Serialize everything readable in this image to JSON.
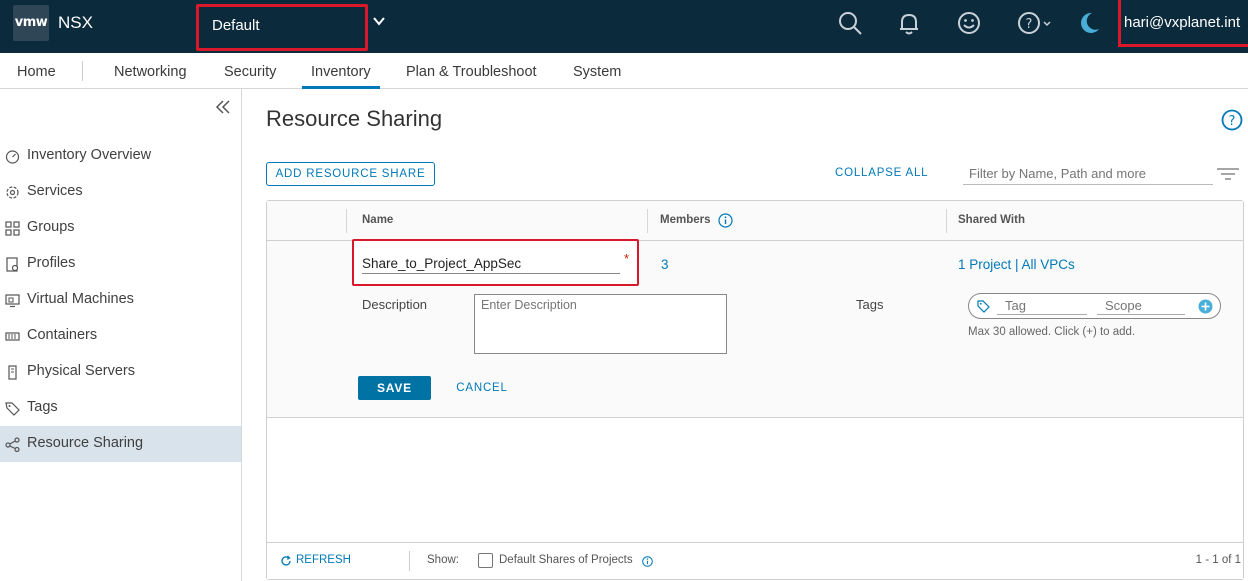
{
  "header": {
    "logo_text": "vmw",
    "product": "NSX",
    "project": "Default",
    "user": "hari@vxplanet.int"
  },
  "nav": {
    "items": [
      "Home",
      "Networking",
      "Security",
      "Inventory",
      "Plan & Troubleshoot",
      "System"
    ],
    "active": "Inventory"
  },
  "sidebar": {
    "items": [
      {
        "label": "Inventory Overview",
        "icon": "gauge-icon"
      },
      {
        "label": "Services",
        "icon": "gear-icon"
      },
      {
        "label": "Groups",
        "icon": "groups-icon"
      },
      {
        "label": "Profiles",
        "icon": "profile-icon"
      },
      {
        "label": "Virtual Machines",
        "icon": "vm-icon"
      },
      {
        "label": "Containers",
        "icon": "container-icon"
      },
      {
        "label": "Physical Servers",
        "icon": "server-icon"
      },
      {
        "label": "Tags",
        "icon": "tag-icon"
      },
      {
        "label": "Resource Sharing",
        "icon": "share-icon"
      }
    ],
    "active": "Resource Sharing"
  },
  "main": {
    "title": "Resource Sharing",
    "add_button": "ADD RESOURCE SHARE",
    "collapse_all": "COLLAPSE ALL",
    "filter_placeholder": "Filter by Name, Path and more",
    "columns": {
      "name": "Name",
      "members": "Members",
      "shared_with": "Shared With"
    },
    "row": {
      "name_value": "Share_to_Project_AppSec",
      "members": "3",
      "shared_with": "1 Project | All VPCs",
      "description_label": "Description",
      "description_placeholder": "Enter Description",
      "tags_label": "Tags",
      "tag_placeholder": "Tag",
      "scope_placeholder": "Scope",
      "tag_hint": "Max 30 allowed. Click (+) to add.",
      "save": "SAVE",
      "cancel": "CANCEL"
    },
    "footer": {
      "refresh": "REFRESH",
      "show": "Show:",
      "default_shares": "Default Shares of Projects",
      "pager": "1 - 1 of 1"
    }
  },
  "colors": {
    "header_bg": "#0b2a3c",
    "accent": "#0079b8",
    "highlight_red": "#d9192a",
    "sidebar_active": "#d8e3eb"
  }
}
